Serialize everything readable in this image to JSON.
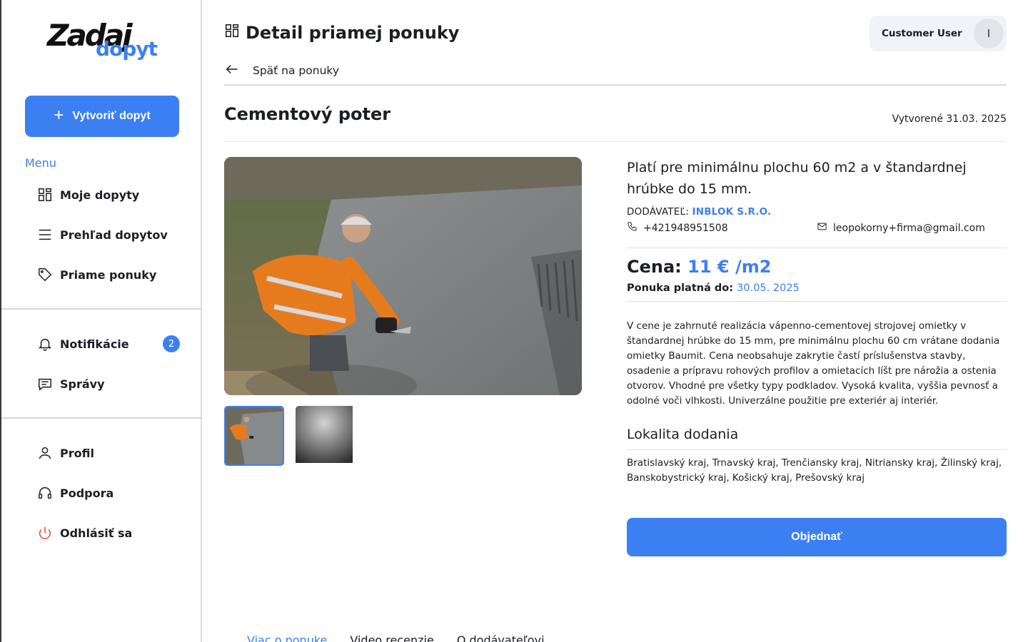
{
  "logo": {
    "main": "Zadaj",
    "sub": "dopyt"
  },
  "sidebar": {
    "create_label": "Vytvoriť dopyt",
    "menu_label": "Menu",
    "items": [
      {
        "label": "Moje dopyty",
        "icon": "grid-icon"
      },
      {
        "label": "Prehľad dopytov",
        "icon": "list-icon"
      },
      {
        "label": "Priame ponuky",
        "icon": "tag-icon"
      },
      {
        "label": "Notifikácie",
        "icon": "bell-icon",
        "badge": "2"
      },
      {
        "label": "Správy",
        "icon": "message-icon"
      },
      {
        "label": "Profil",
        "icon": "user-icon"
      },
      {
        "label": "Podpora",
        "icon": "headset-icon"
      },
      {
        "label": "Odhlásiť sa",
        "icon": "power-icon"
      }
    ]
  },
  "header": {
    "title": "Detail priamej ponuky",
    "user_name": "Customer User",
    "avatar_initial": "I",
    "back_label": "Späť na ponuky"
  },
  "product": {
    "title": "Cementový poter",
    "created": "Vytvorené 31.03. 2025",
    "headline": "Platí pre minimálnu plochu 60 m2 a v štandardnej hrúbke do 15 mm.",
    "supplier_label": "DODÁVATEĽ:",
    "supplier_name": "INBLOK S.R.O.",
    "phone": "+421948951508",
    "email": "leopokorny+firma@gmail.com",
    "price_label": "Cena:",
    "price_value": "11 € /m2",
    "valid_label": "Ponuka platná do:",
    "valid_date": "30.05. 2025",
    "description": "V cene je zahrnuté realizácia vápenno-cementovej strojovej omietky v štandardnej hrúbke do 15 mm, pre minimálnu plochu 60 cm vrátane dodania omietky Baumit. Cena neobsahuje zakrytie častí príslušenstva stavby, osadenie a prípravu rohových profilov a omietacích líšt pre nárožia a ostenia otvorov. Vhodné pre všetky typy podkladov. Vysoká kvalita, vyššia pevnosť a odolné voči vlhkosti. Univerzálne použitie pre exteriér aj interiér.",
    "location_title": "Lokalita dodania",
    "locations": "Bratislavský kraj, Trnavský kraj, Trenčiansky kraj, Nitriansky kraj, Žilinský kraj, Banskobystrický kraj, Košický kraj, Prešovský kraj",
    "order_label": "Objednať"
  },
  "tabs": [
    {
      "label": "Viac o ponuke",
      "active": true
    },
    {
      "label": "Video recenzie",
      "active": false
    },
    {
      "label": "O dodávateľovi",
      "active": false
    }
  ],
  "colors": {
    "accent": "#3b7ff2",
    "text": "#1b1e23",
    "logout": "#e5483b"
  }
}
